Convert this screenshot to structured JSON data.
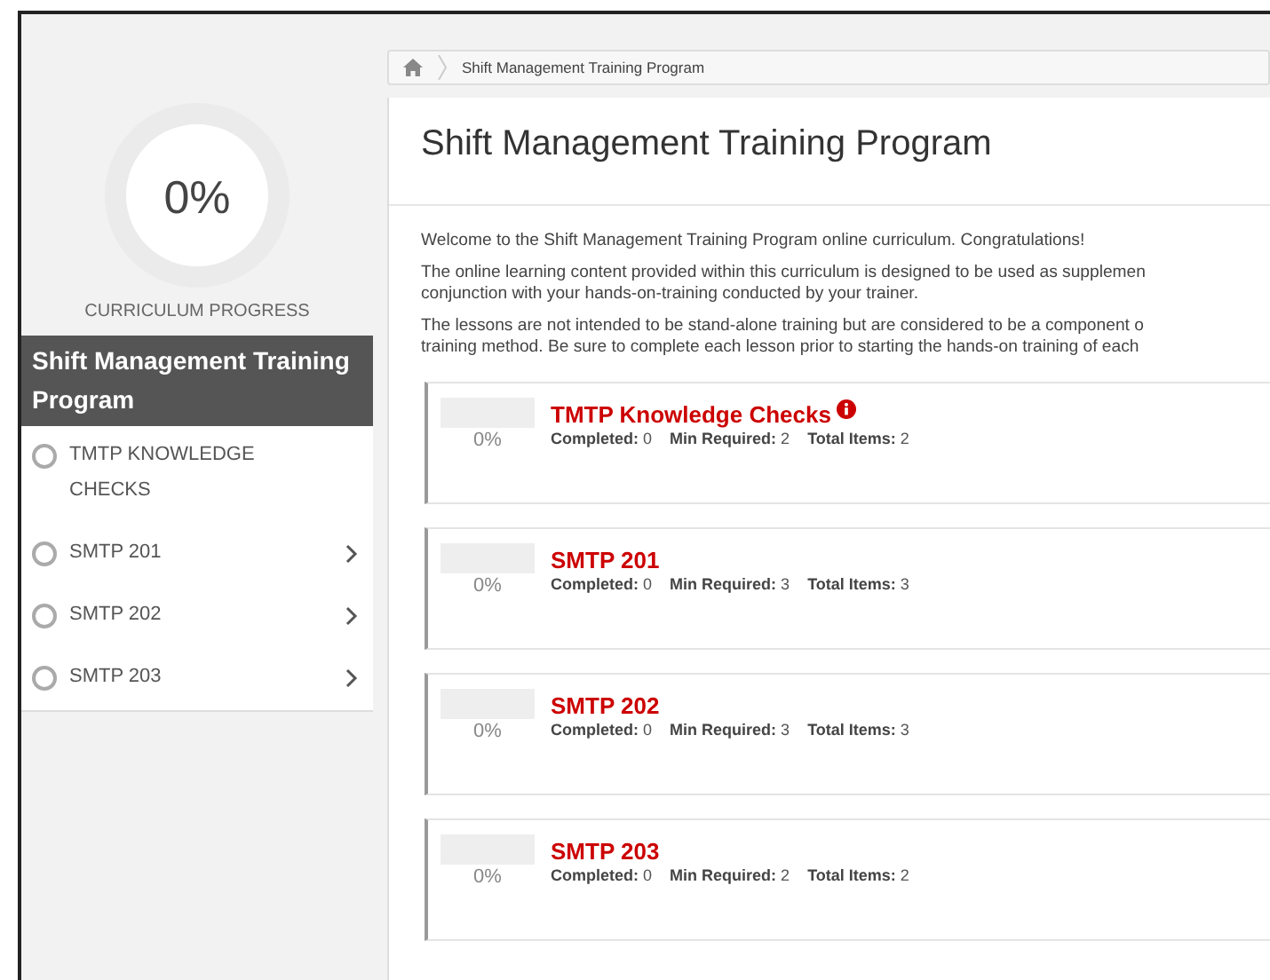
{
  "progress": {
    "percent": "0%",
    "label": "CURRICULUM PROGRESS"
  },
  "sidebar": {
    "title": "Shift Management Training Program",
    "items": [
      {
        "label": "TMTP KNOWLEDGE CHECKS",
        "checked": false,
        "expandable": false
      },
      {
        "label": "SMTP 201",
        "checked": false,
        "expandable": true
      },
      {
        "label": "SMTP 202",
        "checked": false,
        "expandable": true
      },
      {
        "label": "SMTP 203",
        "checked": false,
        "expandable": true
      }
    ]
  },
  "breadcrumb": {
    "items": [
      "Shift Management Training Program"
    ]
  },
  "page": {
    "title": "Shift Management Training Program",
    "paragraphs": [
      [
        "Welcome to the Shift Management Training Program online curriculum.  Congratulations!"
      ],
      [
        "The online learning content provided within this curriculum is designed to be used as supplemen",
        "conjunction with your hands-on-training conducted by your trainer."
      ],
      [
        "The lessons are not intended to be stand-alone training but are considered to be a component o",
        "training method.  Be sure to complete each lesson prior to starting the hands-on training of each"
      ]
    ]
  },
  "modules": [
    {
      "title": "TMTP Knowledge Checks",
      "info": true,
      "level": 0,
      "percent": "0%",
      "stats": [
        {
          "label": "Completed:",
          "value": "0"
        },
        {
          "label": "Min Required:",
          "value": "2"
        },
        {
          "label": "Total Items:",
          "value": "2"
        }
      ]
    },
    {
      "title": "SMTP 201",
      "info": false,
      "level": 0,
      "percent": "0%",
      "stats": [
        {
          "label": "Completed:",
          "value": "0"
        },
        {
          "label": "Min Required:",
          "value": "3"
        },
        {
          "label": "Total Items:",
          "value": "3"
        }
      ]
    },
    {
      "title": "SMTP 202",
      "info": false,
      "level": 0,
      "percent": "0%",
      "stats": [
        {
          "label": "Completed:",
          "value": "0"
        },
        {
          "label": "Min Required:",
          "value": "3"
        },
        {
          "label": "Total Items:",
          "value": "3"
        }
      ]
    },
    {
      "title": "SMTP 203",
      "info": false,
      "level": 0,
      "percent": "0%",
      "stats": [
        {
          "label": "Completed:",
          "value": "0"
        },
        {
          "label": "Min Required:",
          "value": "2"
        },
        {
          "label": "Total Items:",
          "value": "2"
        }
      ]
    }
  ]
}
